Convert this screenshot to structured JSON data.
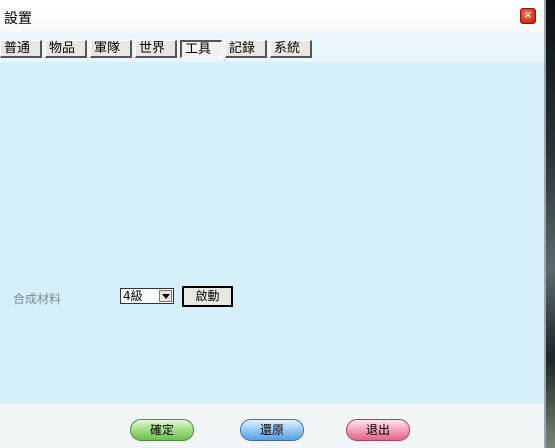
{
  "window": {
    "title": "設置",
    "close_symbol": "✕"
  },
  "tabs": [
    {
      "label": "普通"
    },
    {
      "label": "物品"
    },
    {
      "label": "軍隊"
    },
    {
      "label": "世界"
    },
    {
      "label": "工具",
      "active": true
    },
    {
      "label": "記錄"
    },
    {
      "label": "系統"
    }
  ],
  "tools": {
    "material_label": "合成材料",
    "level_select": {
      "value": "4級"
    },
    "start_label": "啟動"
  },
  "footer": {
    "confirm_label": "確定",
    "restore_label": "還原",
    "exit_label": "退出"
  }
}
